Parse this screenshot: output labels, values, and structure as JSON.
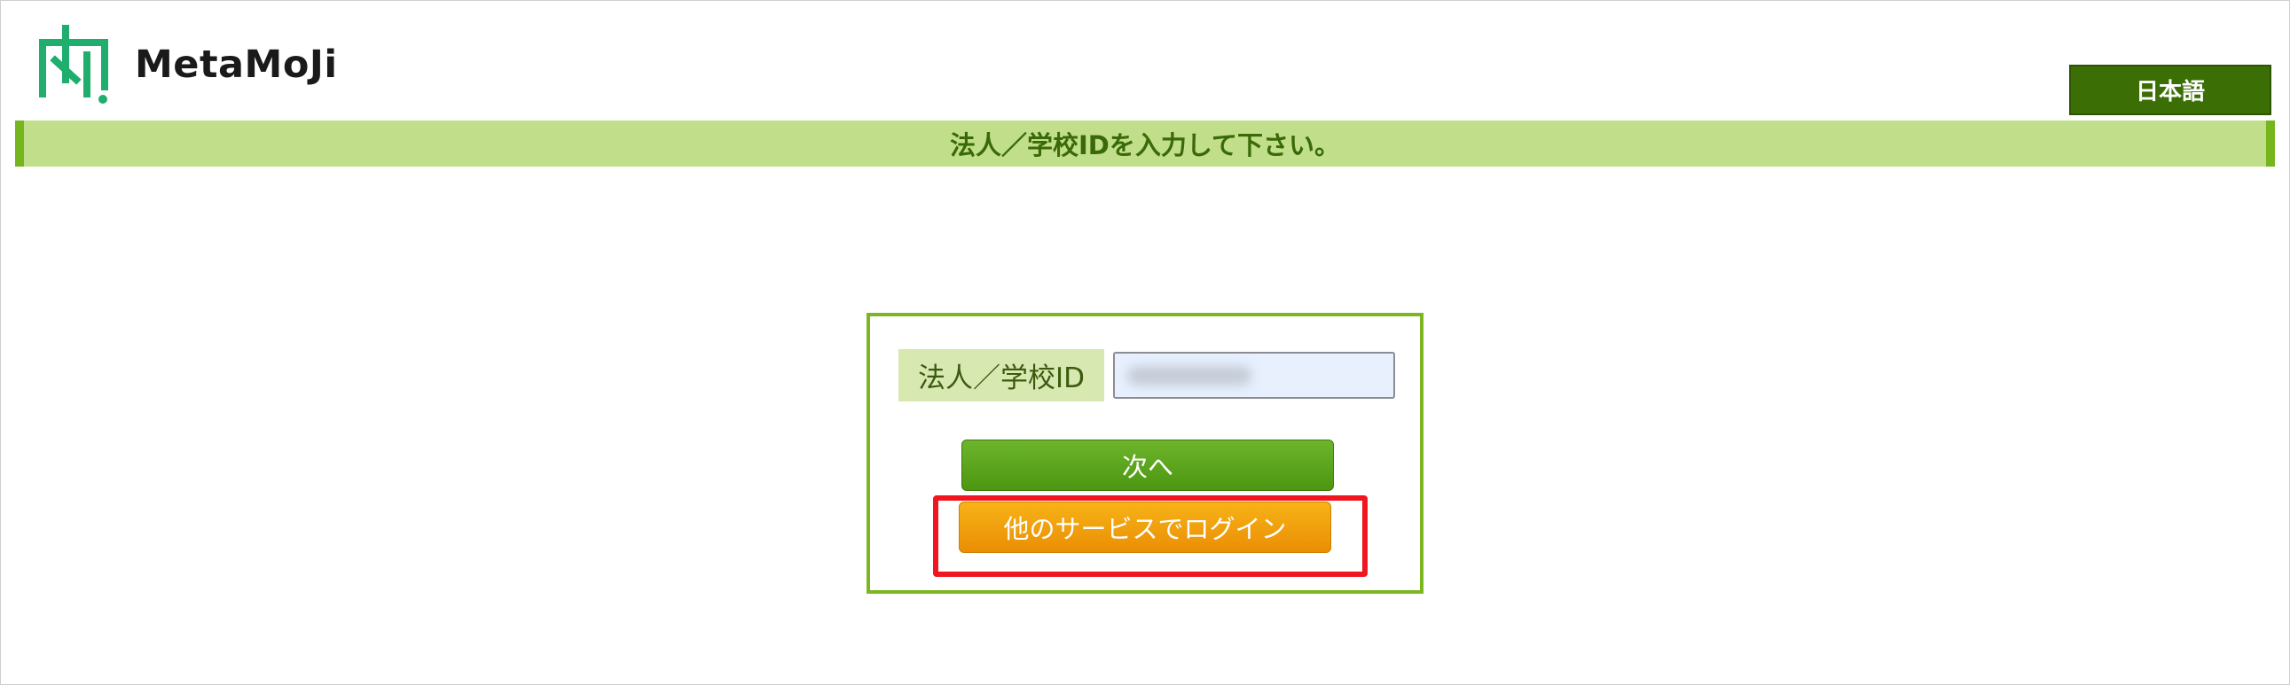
{
  "header": {
    "logo_text": "MetaMoJi",
    "language_button": "日本語"
  },
  "banner": {
    "text": "法人／学校IDを入力して下さい。"
  },
  "login": {
    "id_label": "法人／学校ID",
    "id_value": "",
    "next_button": "次へ",
    "other_service_button": "他のサービスでログイン"
  },
  "colors": {
    "brand_green": "#1fae6e",
    "dark_green": "#3b6e05",
    "banner_bg": "#c1de8a",
    "banner_text": "#3a6a08",
    "box_border": "#7cb620",
    "next_button": "#5aa51c",
    "other_button": "#f0a010",
    "highlight": "#f0151e"
  }
}
